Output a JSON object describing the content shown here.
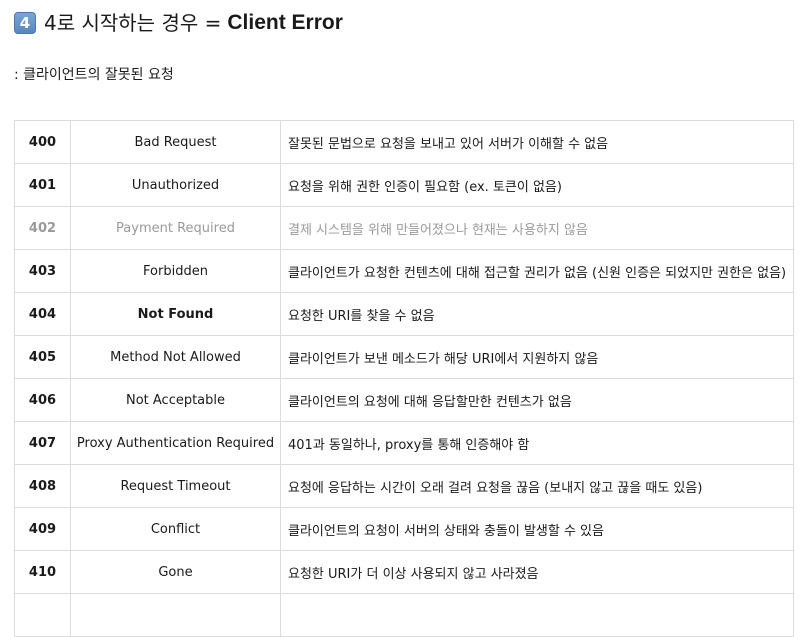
{
  "heading": {
    "badge": "4",
    "title_ko": "4로 시작하는 경우 =",
    "title_en": "Client Error"
  },
  "subtitle": ": 클라이언트의 잘못된 요청",
  "rows": [
    {
      "code": "400",
      "name": "Bad Request",
      "desc": "잘못된 문법으로 요청을 보내고 있어 서버가 이해할 수 없음"
    },
    {
      "code": "401",
      "name": "Unauthorized",
      "desc": "요청을 위해 권한 인증이 필요함 (ex. 토큰이 없음)"
    },
    {
      "code": "402",
      "name": "Payment Required",
      "desc": "결제 시스템을 위해 만들어졌으나 현재는 사용하지 않음"
    },
    {
      "code": "403",
      "name": "Forbidden",
      "desc": "클라이언트가 요청한 컨텐츠에 대해 접근할 권리가 없음 (신원 인증은 되었지만 권한은 없음)"
    },
    {
      "code": "404",
      "name": "Not Found",
      "desc": "요청한 URI를 찾을 수 없음"
    },
    {
      "code": "405",
      "name": "Method Not Allowed",
      "desc": "클라이언트가 보낸 메소드가 해당 URI에서 지원하지 않음"
    },
    {
      "code": "406",
      "name": "Not Acceptable",
      "desc": "클라이언트의 요청에 대해 응답할만한 컨텐츠가 없음"
    },
    {
      "code": "407",
      "name": "Proxy Authentication Required",
      "desc": "401과 동일하나, proxy를 통해 인증해야 함"
    },
    {
      "code": "408",
      "name": "Request Timeout",
      "desc": "요청에 응답하는 시간이 오래 걸려 요청을 끊음 (보내지 않고 끊을 때도 있음)"
    },
    {
      "code": "409",
      "name": "Conflict",
      "desc": "클라이언트의 요청이 서버의 상태와 충돌이 발생할 수 있음"
    },
    {
      "code": "410",
      "name": "Gone",
      "desc": "요청한 URI가 더 이상 사용되지 않고 사라졌음"
    },
    {
      "code": "",
      "name": "",
      "desc": ""
    }
  ],
  "colors": {
    "muted_text": "#9a9a9a",
    "border": "#dcdcdc",
    "keycap": "#6a96ca"
  }
}
